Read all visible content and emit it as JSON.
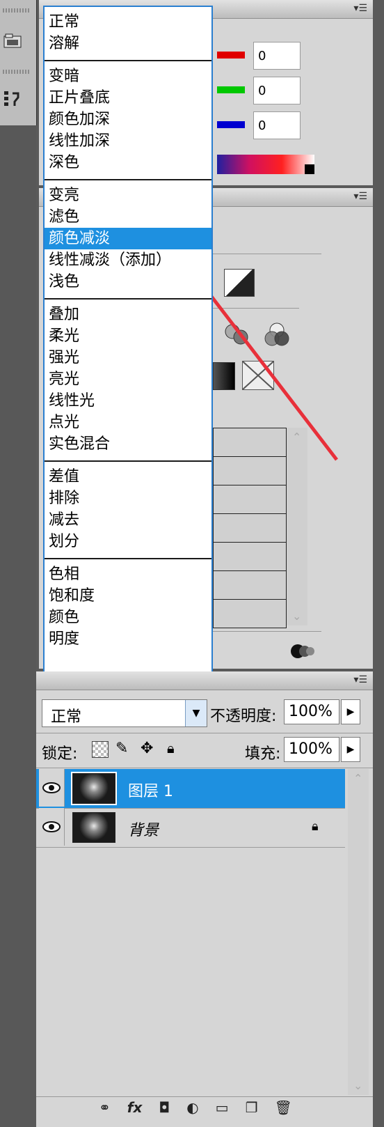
{
  "dock": {
    "icons": [
      "folder-icon",
      "history-icon"
    ]
  },
  "color_panel": {
    "r_value": "0",
    "g_value": "0",
    "b_value": "0"
  },
  "blend_menu": {
    "groups": [
      [
        "正常",
        "溶解"
      ],
      [
        "变暗",
        "正片叠底",
        "颜色加深",
        "线性加深",
        "深色"
      ],
      [
        "变亮",
        "滤色",
        "颜色减淡",
        "线性减淡（添加）",
        "浅色"
      ],
      [
        "叠加",
        "柔光",
        "强光",
        "亮光",
        "线性光",
        "点光",
        "实色混合"
      ],
      [
        "差值",
        "排除",
        "减去",
        "划分"
      ],
      [
        "色相",
        "饱和度",
        "颜色",
        "明度"
      ]
    ],
    "selected": "颜色减淡"
  },
  "layers_panel": {
    "blend_mode": "正常",
    "opacity_label": "不透明度:",
    "opacity_value": "100%",
    "lock_label": "锁定:",
    "fill_label": "填充:",
    "fill_value": "100%",
    "layers": [
      {
        "name": "图层 1",
        "selected": true,
        "locked": false
      },
      {
        "name": "背景",
        "selected": false,
        "locked": true
      }
    ]
  },
  "colors": {
    "accent": "#1e90e0",
    "arrow": "#e8303a",
    "panel": "#d6d6d6"
  }
}
